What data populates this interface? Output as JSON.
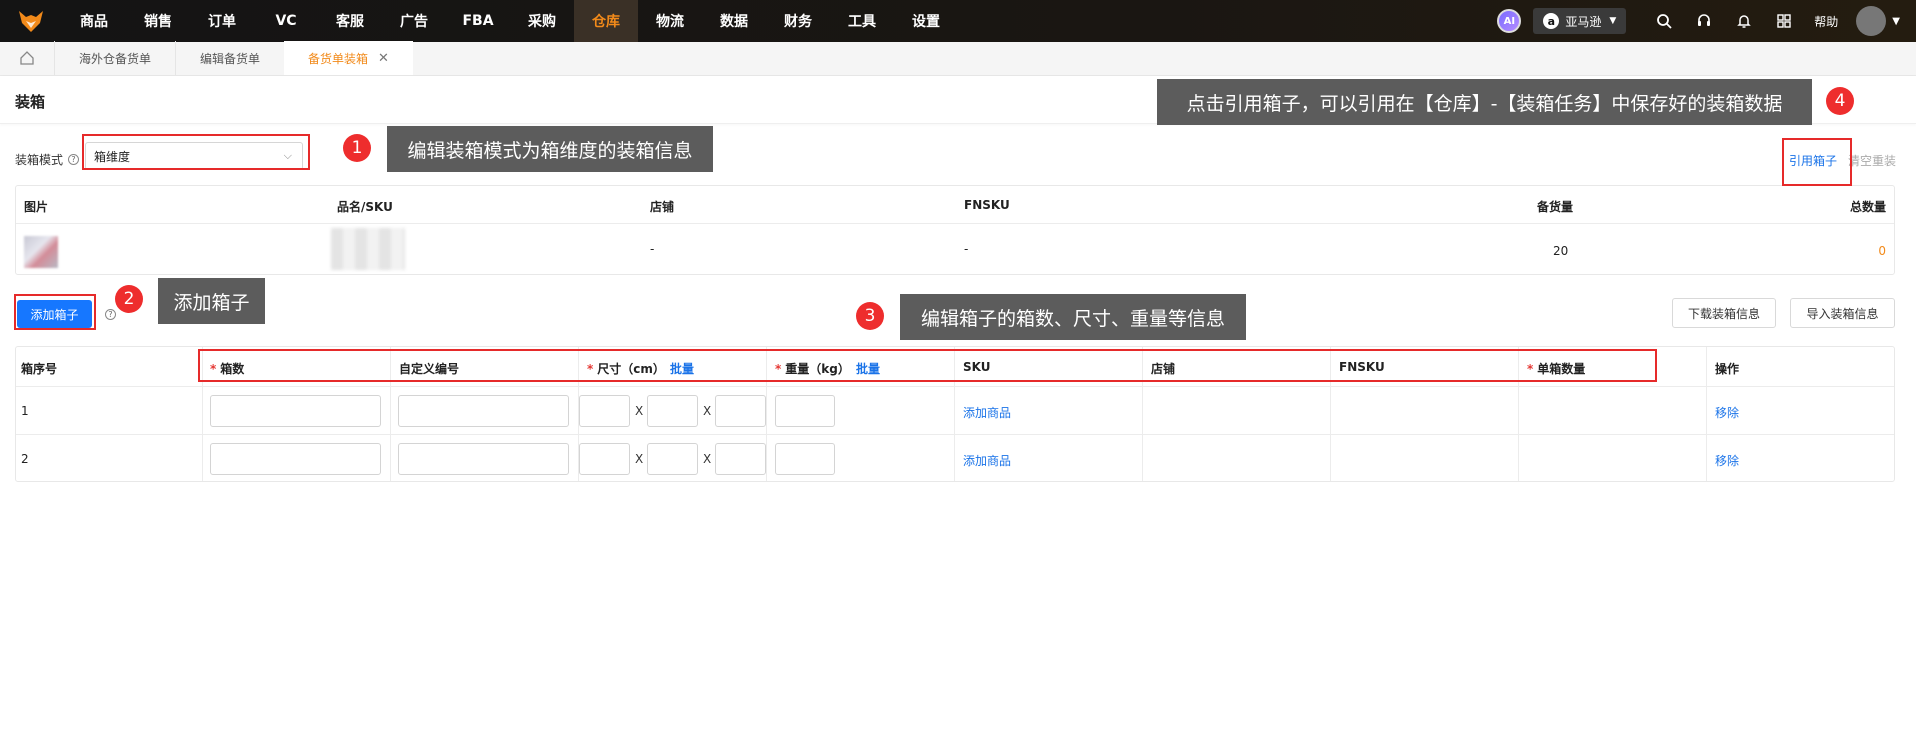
{
  "nav": {
    "items": [
      "商品",
      "销售",
      "订单",
      "VC",
      "客服",
      "广告",
      "FBA",
      "采购",
      "仓库",
      "物流",
      "数据",
      "财务",
      "工具",
      "设置"
    ],
    "active": "仓库",
    "ai_label": "AI",
    "store_icon": "a",
    "store_label": "亚马逊",
    "help_label": "帮助"
  },
  "tabs": [
    {
      "label": "海外仓备货单"
    },
    {
      "label": "编辑备货单"
    },
    {
      "label": "备货单装箱",
      "close": "✕"
    }
  ],
  "page": {
    "title": "装箱"
  },
  "mode": {
    "label": "装箱模式",
    "value": "箱维度",
    "help": "?"
  },
  "actions": {
    "reference_box": "引用箱子",
    "clear_packing": "清空重装"
  },
  "products": {
    "headers": [
      "图片",
      "品名/SKU",
      "店铺",
      "FNSKU",
      "备货量",
      "总数量"
    ],
    "rows": [
      {
        "store": "-",
        "fnsku": "-",
        "qty": "20",
        "total": "0"
      }
    ]
  },
  "boxes": {
    "add_label": "添加箱子",
    "download_label": "下载装箱信息",
    "import_label": "导入装箱信息",
    "headers": {
      "box_no": "箱序号",
      "box_count": "箱数",
      "custom_code": "自定义编号",
      "size": "尺寸（cm）",
      "batch": "批量",
      "weight": "重量（kg）",
      "sku": "SKU",
      "store": "店铺",
      "fnsku": "FNSKU",
      "unit_qty": "单箱数量",
      "op": "操作"
    },
    "required_mark": "*",
    "x_sep": "X",
    "rows": [
      {
        "no": "1",
        "add_product": "添加商品",
        "remove": "移除"
      },
      {
        "no": "2",
        "add_product": "添加商品",
        "remove": "移除"
      }
    ]
  },
  "annotations": [
    {
      "num": "1",
      "text": "编辑装箱模式为箱维度的装箱信息"
    },
    {
      "num": "2",
      "text": "添加箱子"
    },
    {
      "num": "3",
      "text": "编辑箱子的箱数、尺寸、重量等信息"
    },
    {
      "num": "4",
      "text": "点击引用箱子，可以引用在【仓库】-【装箱任务】中保存好的装箱数据"
    }
  ],
  "colors": {
    "accent": "#f28a1a",
    "primary": "#1677ff",
    "annotation_red": "#e62a2a",
    "tip_bg": "#5c5c5c"
  }
}
